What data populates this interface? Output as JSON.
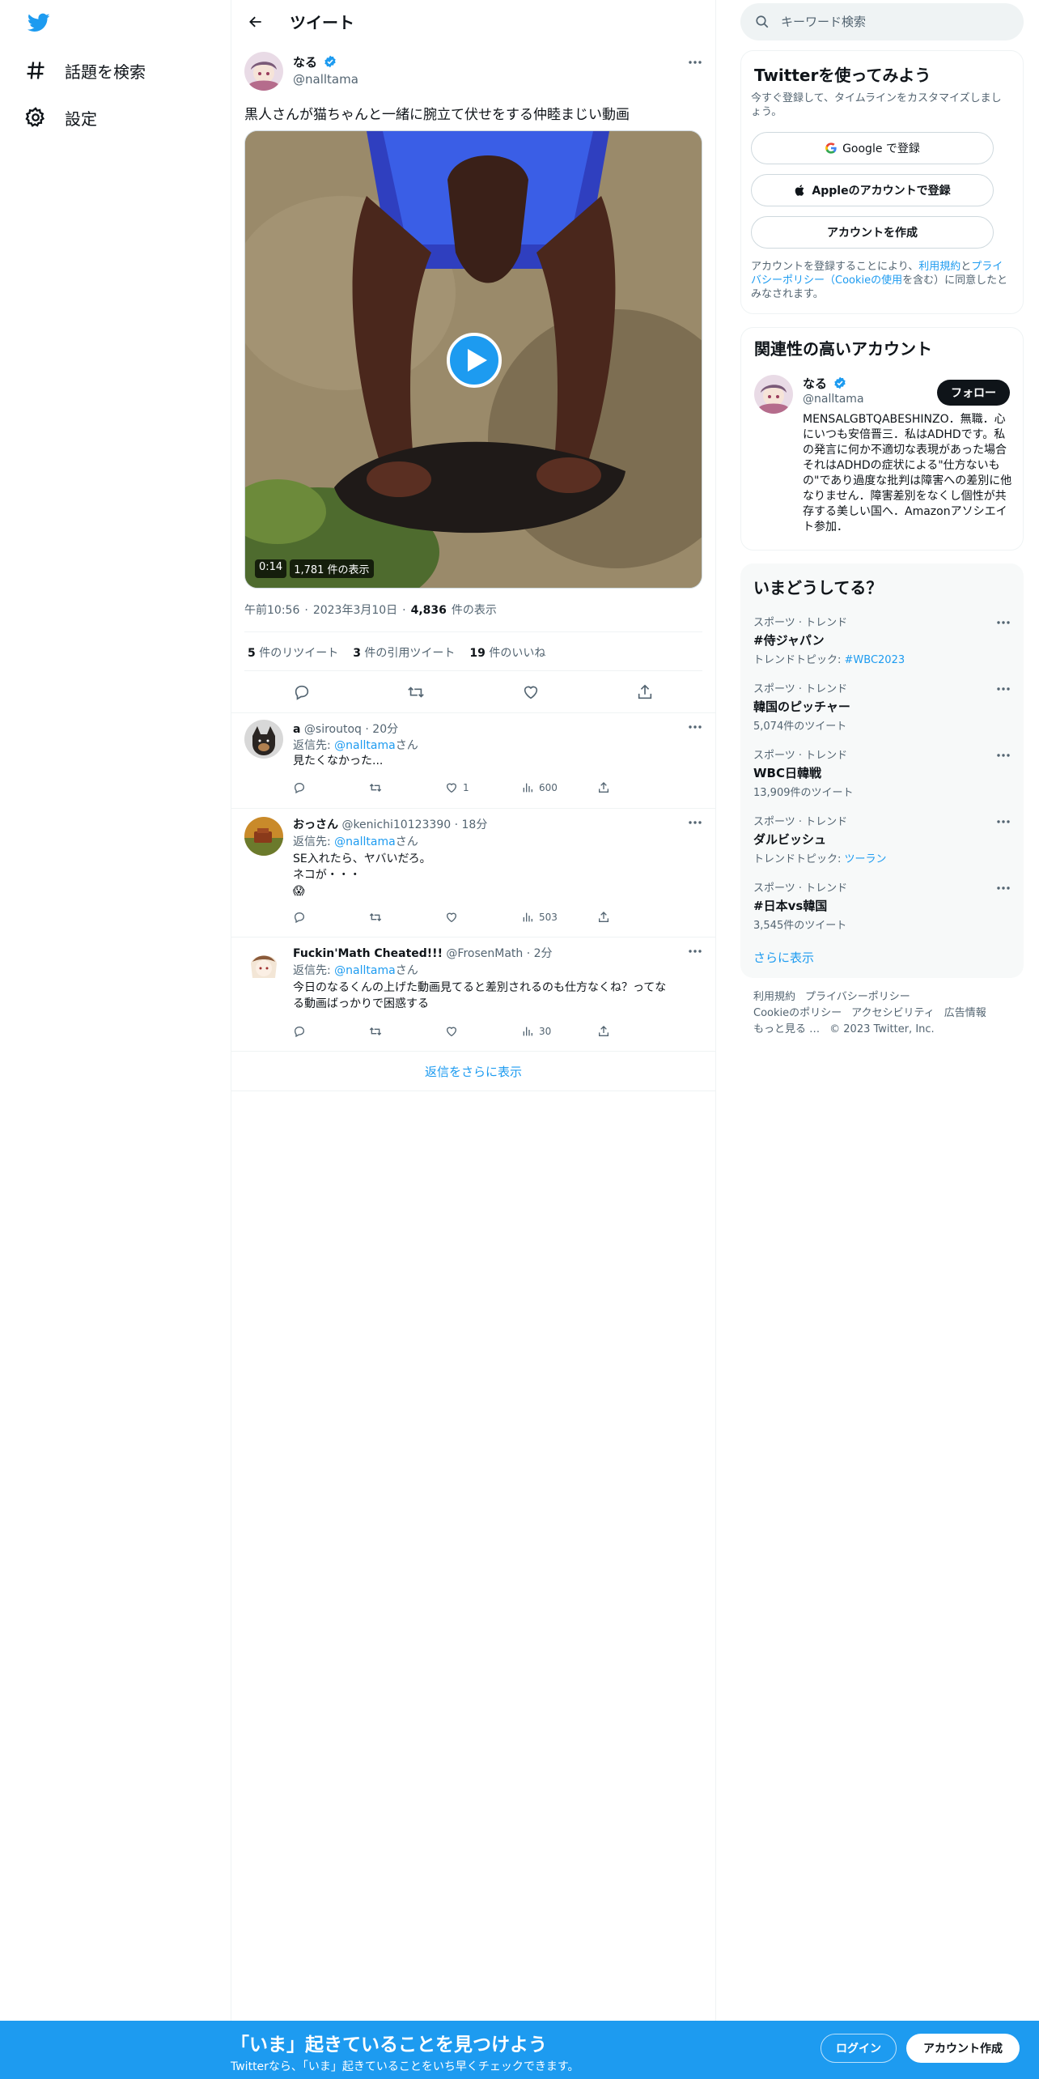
{
  "nav": {
    "items": [
      {
        "label": "話題を検索",
        "icon": "hashtag-icon"
      },
      {
        "label": "設定",
        "icon": "gear-icon"
      }
    ]
  },
  "header": {
    "title": "ツイート"
  },
  "tweet": {
    "author": "なる",
    "handle": "@nalltama",
    "text": "黒人さんが猫ちゃんと一緒に腕立て伏せをする仲睦まじい動画",
    "video": {
      "duration": "0:14",
      "views_badge": "1,781 件の表示"
    },
    "time": "午前10:56",
    "date": "2023年3月10日",
    "views_count": "4,836",
    "views_label": "件の表示",
    "stats": {
      "retweets": "5",
      "retweets_label": "件のリツイート",
      "quotes": "3",
      "quotes_label": "件の引用ツイート",
      "likes": "19",
      "likes_label": "件のいいね"
    }
  },
  "replies": [
    {
      "name": "a",
      "handle": "@siroutoq",
      "time": "20分",
      "reply_prefix": "返信先: ",
      "reply_to": "@nalltama",
      "reply_suffix": "さん",
      "lines": [
        "見たくなかった..."
      ],
      "likes": "1",
      "views": "600"
    },
    {
      "name": "おっさん",
      "handle": "@kenichi10123390",
      "time": "18分",
      "reply_prefix": "返信先: ",
      "reply_to": "@nalltama",
      "reply_suffix": "さん",
      "lines": [
        "SE入れたら、ヤバいだろ。",
        "ネコが・・・",
        "😱"
      ],
      "likes": "",
      "views": "503"
    },
    {
      "name": "Fuckin'Math Cheated!!!",
      "handle": "@FrosenMath",
      "time": "2分",
      "reply_prefix": "返信先: ",
      "reply_to": "@nalltama",
      "reply_suffix": "さん",
      "lines": [
        "今日のなるくんの上げた動画見てると差別されるのも仕方なくね？ってな",
        "る動画ばっかりで困惑する"
      ],
      "likes": "",
      "views": "30"
    }
  ],
  "show_more_replies": "返信をさらに表示",
  "search": {
    "placeholder": "キーワード検索"
  },
  "signup_card": {
    "title": "Twitterを使ってみよう",
    "subtitle": "今すぐ登録して、タイムラインをカスタマイズしましょう。",
    "google": "Google で登録",
    "apple": "Appleのアカウントで登録",
    "create": "アカウントを作成",
    "terms_1": "アカウントを登録することにより、",
    "terms_link1": "利用規約",
    "terms_2": "と",
    "terms_link2": "プライバシーポリシー（Cookieの使用",
    "terms_3": "を含む）に同意したとみなされます。"
  },
  "related": {
    "title": "関連性の高いアカウント",
    "name": "なる",
    "handle": "@nalltama",
    "follow": "フォロー",
    "bio": "MENSALGBTQABESHINZO．無職．心にいつも安倍晋三．私はADHDです。私の発言に何か不適切な表現があった場合それはADHDの症状による\"仕方ないもの\"であり過度な批判は障害への差別に他なりません．障害差別をなくし個性が共存する美しい国へ．Amazonアソシエイト参加．"
  },
  "trends": {
    "title": "いまどうしてる？",
    "items": [
      {
        "category": "スポーツ · トレンド",
        "name": "#侍ジャパン",
        "sub_prefix": "トレンドトピック: ",
        "sub_link": "#WBC2023",
        "sub": ""
      },
      {
        "category": "スポーツ · トレンド",
        "name": "韓国のピッチャー",
        "sub_prefix": "",
        "sub_link": "",
        "sub": "5,074件のツイート"
      },
      {
        "category": "スポーツ · トレンド",
        "name": "WBC日韓戦",
        "sub_prefix": "",
        "sub_link": "",
        "sub": "13,909件のツイート"
      },
      {
        "category": "スポーツ · トレンド",
        "name": "ダルビッシュ",
        "sub_prefix": "トレンドトピック: ",
        "sub_link": "ツーラン",
        "sub": ""
      },
      {
        "category": "スポーツ · トレンド",
        "name": "#日本vs韓国",
        "sub_prefix": "",
        "sub_link": "",
        "sub": "3,545件のツイート"
      }
    ],
    "show_more": "さらに表示"
  },
  "footer": {
    "links": [
      "利用規約",
      "プライバシーポリシー",
      "Cookieのポリシー",
      "アクセシビリティ",
      "広告情報",
      "もっと見る …"
    ],
    "copyright": "© 2023 Twitter, Inc."
  },
  "bottom_bar": {
    "title": "「いま」起きていることを見つけよう",
    "subtitle": "Twitterなら、「いま」起きていることをいち早くチェックできます。",
    "login": "ログイン",
    "signup": "アカウント作成"
  },
  "colors": {
    "accent": "#1d9bf0",
    "text": "#0f1419",
    "secondary": "#536471"
  }
}
